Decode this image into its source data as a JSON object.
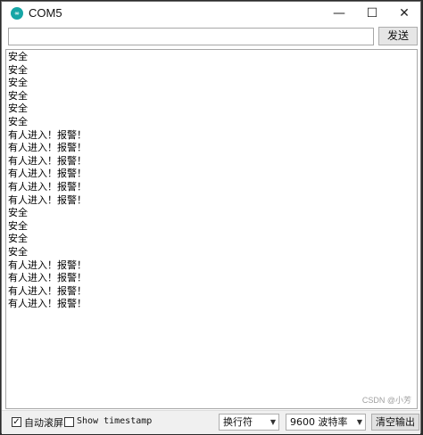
{
  "window": {
    "title": "COM5",
    "icon_text": "∞",
    "minimize_glyph": "—",
    "maximize_glyph": "☐",
    "close_glyph": "✕"
  },
  "input": {
    "value": "",
    "send_label": "发送"
  },
  "output": {
    "lines": [
      "安全",
      "安全",
      "安全",
      "安全",
      "安全",
      "安全",
      "有人进入！报警！",
      "有人进入！报警！",
      "有人进入！报警！",
      "有人进入！报警！",
      "有人进入！报警！",
      "有人进入！报警！",
      "安全",
      "安全",
      "安全",
      "安全",
      "有人进入！报警！",
      "有人进入！报警！",
      "有人进入！报警！",
      "有人进入！报警！"
    ],
    "watermark": "CSDN @小芳"
  },
  "bottom": {
    "autoscroll_checked": "✓",
    "autoscroll_label": "自动滚屏",
    "timestamp_label": "Show timestamp",
    "line_ending": "换行符",
    "baud_rate": "9600 波特率",
    "clear_label": "清空输出"
  }
}
